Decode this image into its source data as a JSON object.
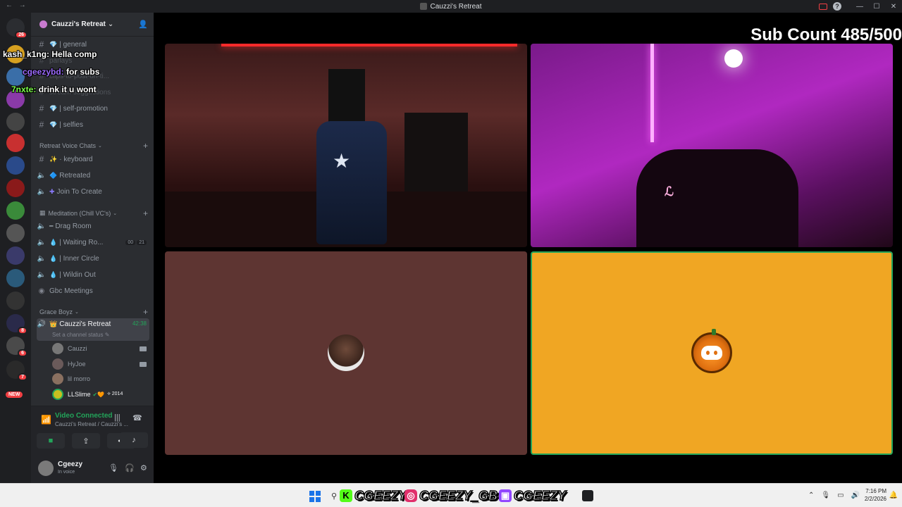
{
  "window": {
    "title": "Cauzzi's Retreat",
    "back": "←",
    "forward": "→",
    "minimize": "—",
    "maximize": "☐",
    "close": "✕"
  },
  "rail": {
    "dm_badge": "26",
    "badges": [
      "8",
      "6",
      "7"
    ],
    "new_label": "NEW"
  },
  "server": {
    "name": "Cauzzi's Retreat",
    "chevron": "⌄"
  },
  "chat_overlay": [
    {
      "user": "kash_k1ng:",
      "message": "Hella comp"
    },
    {
      "user": "cgeezybd:",
      "message": "for subs"
    },
    {
      "user": "7nxte:",
      "message": "drink it u wont"
    }
  ],
  "channels_top": [
    {
      "label": "| general"
    },
    {
      "label": "parlays"
    },
    {
      "label": "clips-to-post-on-ti..."
    },
    {
      "label": "stream-suggestions"
    },
    {
      "label": "| self-promotion"
    },
    {
      "label": "| selfies"
    }
  ],
  "category_retreat": "Retreat Voice Chats",
  "retreat_channels": [
    {
      "label": "· keyboard"
    },
    {
      "label": "Retreated"
    },
    {
      "label": "Join To Create"
    }
  ],
  "category_meditation": "Meditation (Chill VC's)",
  "meditation_channels": [
    {
      "label": "Drag Room"
    },
    {
      "label": "| Waiting Ro...",
      "count_a": "00",
      "count_b": "21"
    },
    {
      "label": "| Inner Circle"
    },
    {
      "label": "| Wildin Out"
    },
    {
      "label": "Gbc Meetings"
    }
  ],
  "category_grace": "Grace Boyz",
  "active_channel": {
    "label": "Cauzzi's Retreat",
    "timer": "42:38",
    "status_hint": "Set a channel status ✎"
  },
  "members": [
    {
      "name": "Cauzzi"
    },
    {
      "name": "HyJoe"
    },
    {
      "name": "lil morro"
    },
    {
      "name": "LLSlime",
      "tag": "⟡ 2014"
    }
  ],
  "voice": {
    "title": "Video Connected",
    "subtitle": "Cauzzi's Retreat / Cauzzi's ..."
  },
  "user": {
    "name": "Cgeezy",
    "status": "In voice"
  },
  "stage": {
    "sub_count": "Sub Count 485/500"
  },
  "taskbar": {
    "handles": [
      {
        "icon": "K",
        "handle": "CGEEZY"
      },
      {
        "icon": "◎",
        "handle": "CGEEZY_GBC"
      },
      {
        "icon": "▣",
        "handle": "CGEEZY"
      }
    ],
    "time": "7:16 PM",
    "date": "2/2/2026"
  }
}
